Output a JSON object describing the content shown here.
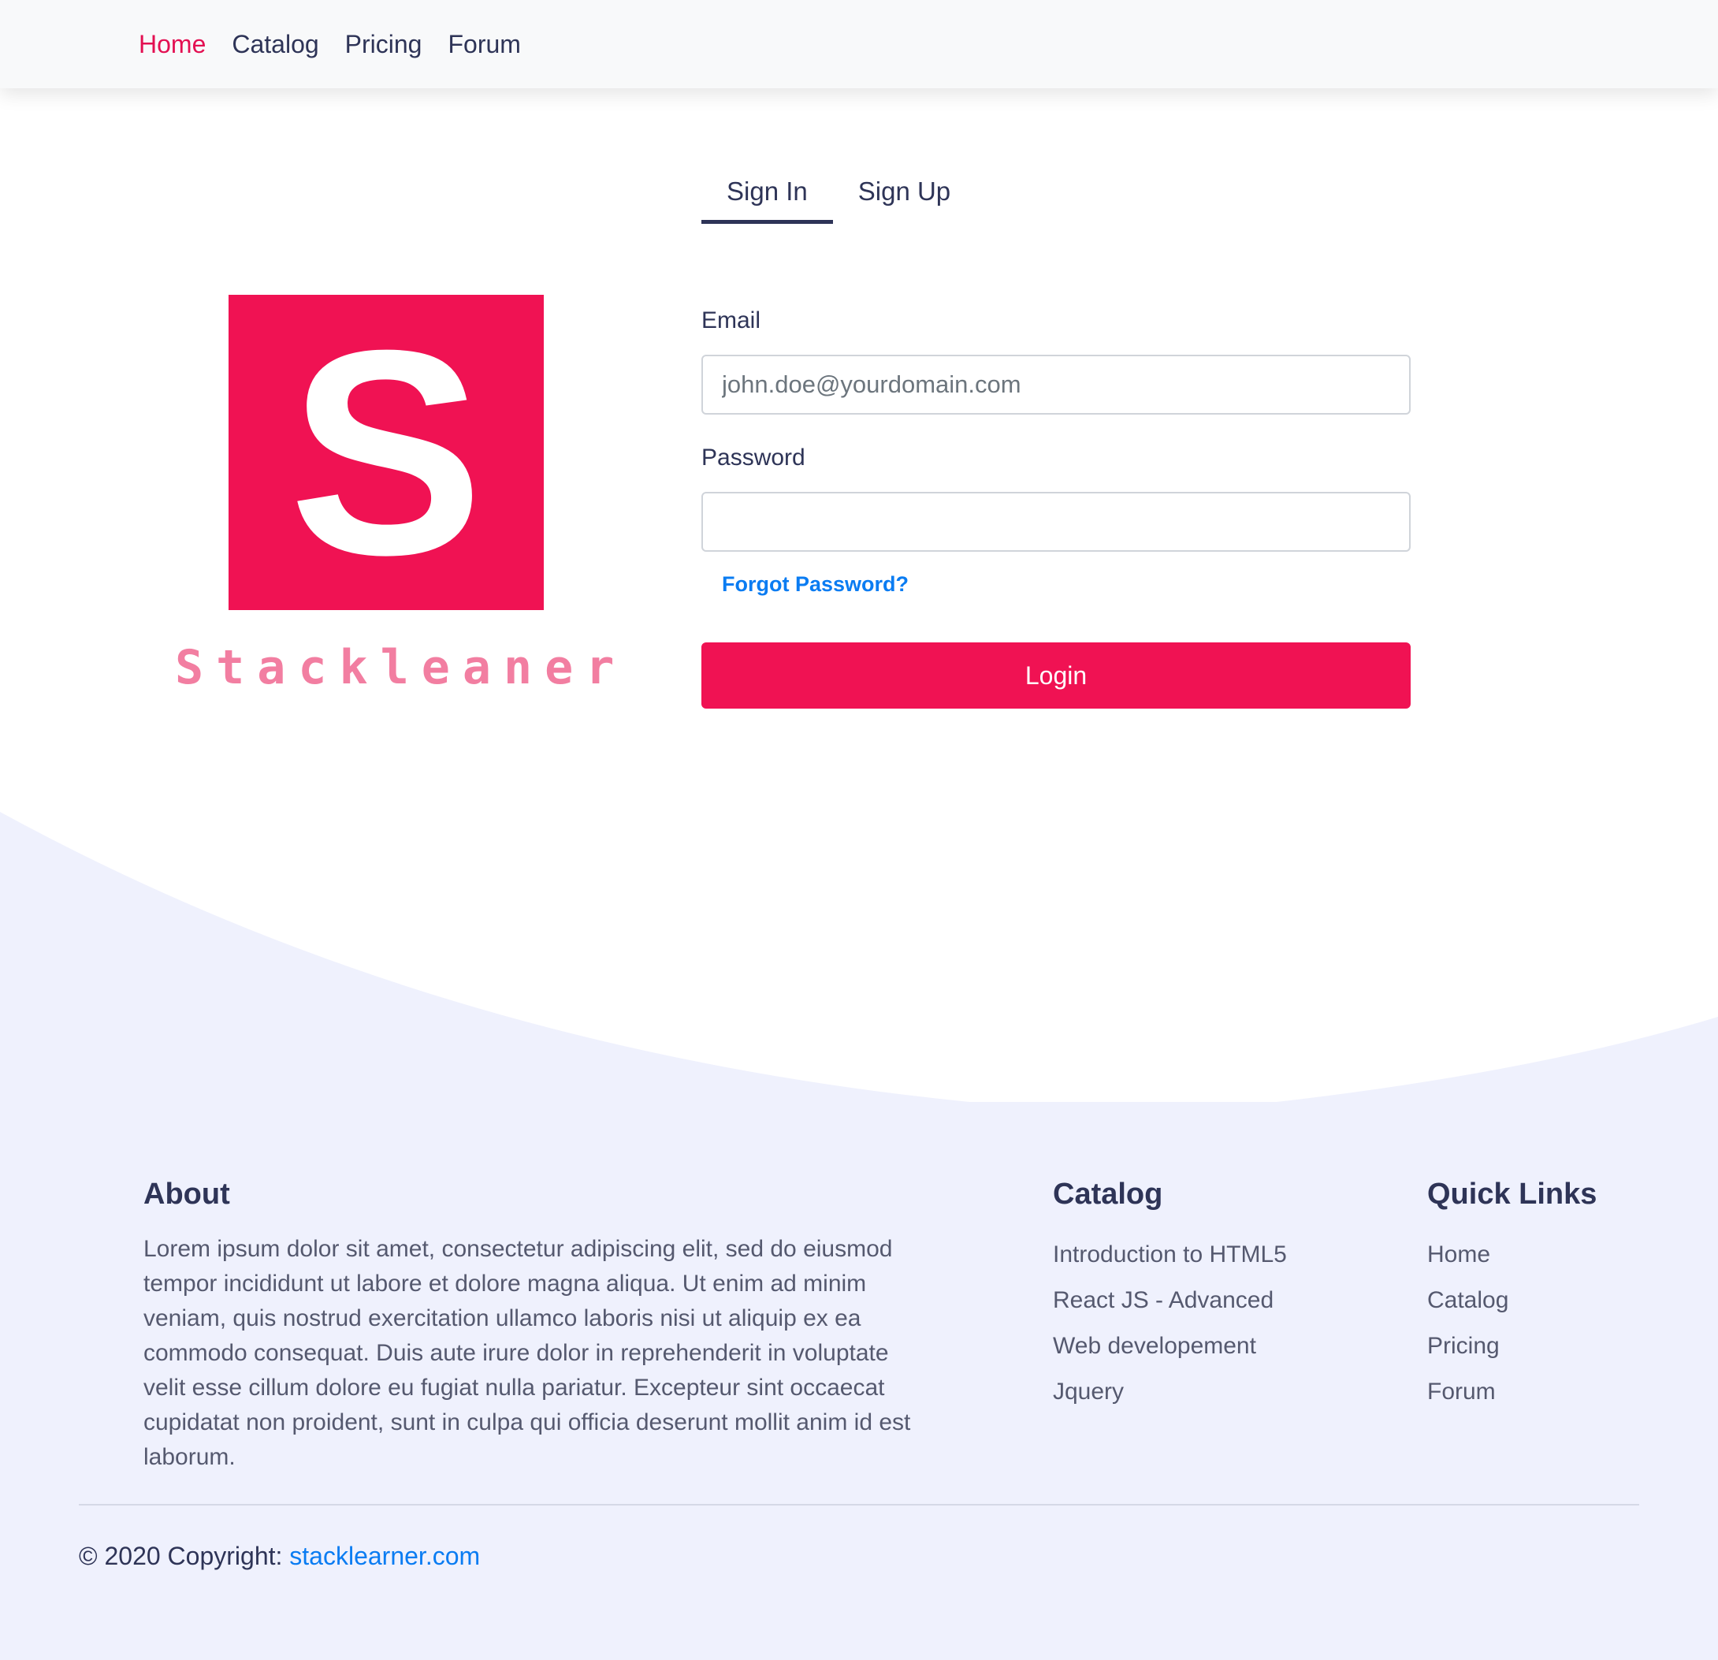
{
  "nav": {
    "items": [
      {
        "label": "Home",
        "active": true
      },
      {
        "label": "Catalog",
        "active": false
      },
      {
        "label": "Pricing",
        "active": false
      },
      {
        "label": "Forum",
        "active": false
      }
    ]
  },
  "auth_tabs": {
    "sign_in": "Sign In",
    "sign_up": "Sign Up",
    "active": "Sign In"
  },
  "brand": {
    "logo_letter": "S",
    "name": "Stackleaner"
  },
  "form": {
    "email_label": "Email",
    "email_placeholder": "john.doe@yourdomain.com",
    "email_value": "",
    "password_label": "Password",
    "password_value": "",
    "forgot_link": "Forgot Password?",
    "submit_label": "Login"
  },
  "footer": {
    "about": {
      "title": "About",
      "text": "Lorem ipsum dolor sit amet, consectetur adipiscing elit, sed do eiusmod tempor incididunt ut labore et dolore magna aliqua. Ut enim ad minim veniam, quis nostrud exercitation ullamco laboris nisi ut aliquip ex ea commodo consequat. Duis aute irure dolor in reprehenderit in voluptate velit esse cillum dolore eu fugiat nulla pariatur. Excepteur sint occaecat cupidatat non proident, sunt in culpa qui officia deserunt mollit anim id est laborum."
    },
    "catalog": {
      "title": "Catalog",
      "items": [
        "Introduction to HTML5",
        "React JS - Advanced",
        "Web developement",
        "Jquery"
      ]
    },
    "quick_links": {
      "title": "Quick Links",
      "items": [
        "Home",
        "Catalog",
        "Pricing",
        "Forum"
      ]
    },
    "copyright_prefix": "© 2020 Copyright:",
    "copyright_link": "stacklearner.com"
  },
  "colors": {
    "brand": "#f01253",
    "nav_active": "#e31052",
    "link": "#0a7cf2",
    "text_dark": "#2e3457",
    "footer_bg": "#eff1fd",
    "navbar_bg": "#f8f9fa"
  }
}
